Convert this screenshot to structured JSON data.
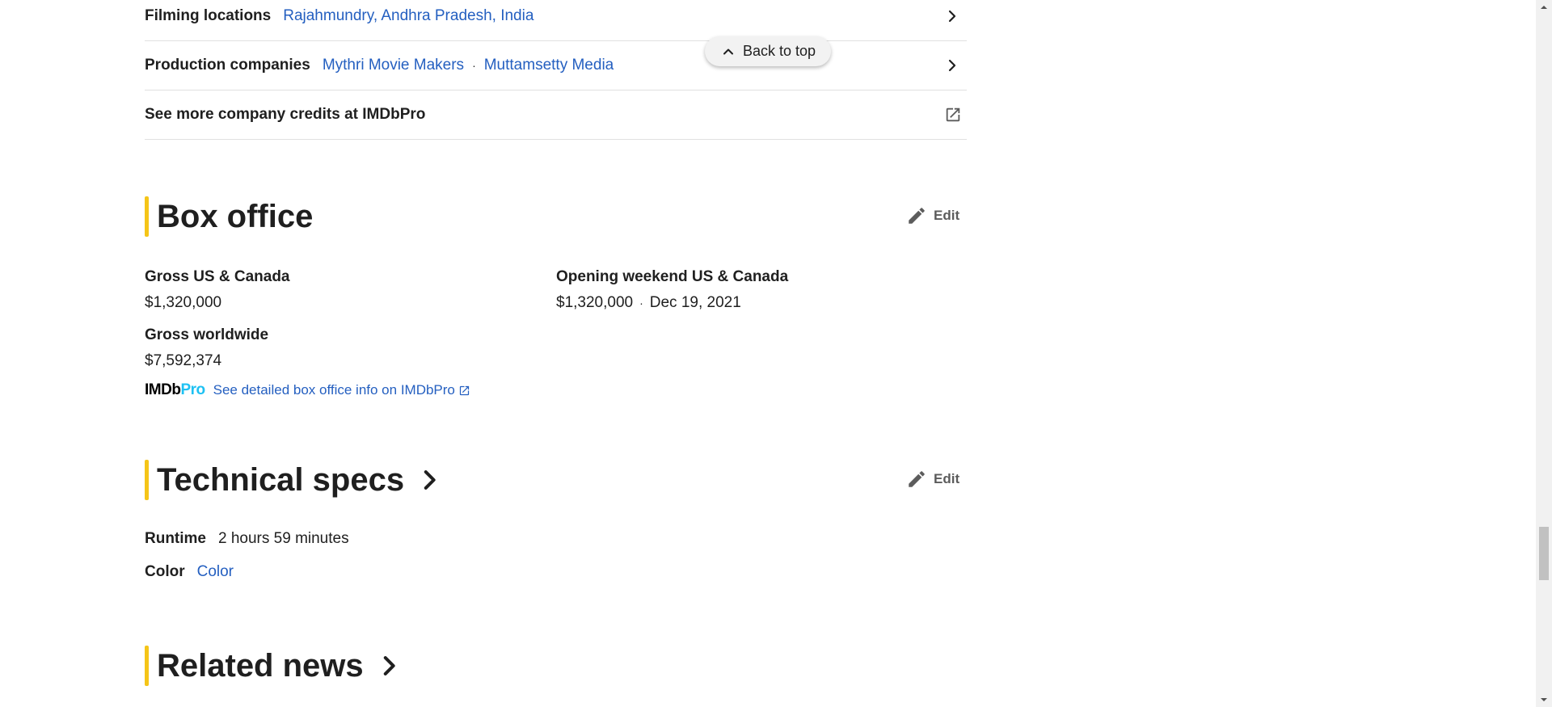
{
  "details": {
    "filming_locations": {
      "label": "Filming locations",
      "links": [
        "Rajahmundry, Andhra Pradesh, India"
      ]
    },
    "production_companies": {
      "label": "Production companies",
      "links": [
        "Mythri Movie Makers",
        "Muttamsetty Media"
      ],
      "separator": "·"
    },
    "company_credits": {
      "label": "See more company credits at IMDbPro"
    }
  },
  "back_to_top": {
    "label": "Back to top"
  },
  "box_office": {
    "title": "Box office",
    "edit_label": "Edit",
    "gross_us": {
      "label": "Gross US & Canada",
      "value": "$1,320,000"
    },
    "gross_worldwide": {
      "label": "Gross worldwide",
      "value": "$7,592,374"
    },
    "opening_weekend": {
      "label": "Opening weekend US & Canada",
      "value": "$1,320,000",
      "separator": "·",
      "date": "Dec 19, 2021"
    },
    "imdbpro": {
      "logo_imdb": "IMDb",
      "logo_pro": "Pro",
      "link": "See detailed box office info on IMDbPro"
    }
  },
  "technical_specs": {
    "title": "Technical specs",
    "edit_label": "Edit",
    "runtime": {
      "label": "Runtime",
      "value": "2 hours 59 minutes"
    },
    "color": {
      "label": "Color",
      "value": "Color"
    }
  },
  "related_news": {
    "title": "Related news"
  },
  "colors": {
    "accent": "#f5c518",
    "link": "#245fc0",
    "imdbpro_blue": "#1ec1f3",
    "text": "#1f1f1f"
  },
  "icons": {
    "row_chevron": "chevron-right-icon",
    "external": "external-link-icon",
    "back_to_top": "chevron-up-icon",
    "edit": "pencil-icon",
    "title_chevron": "chevron-right-icon"
  }
}
